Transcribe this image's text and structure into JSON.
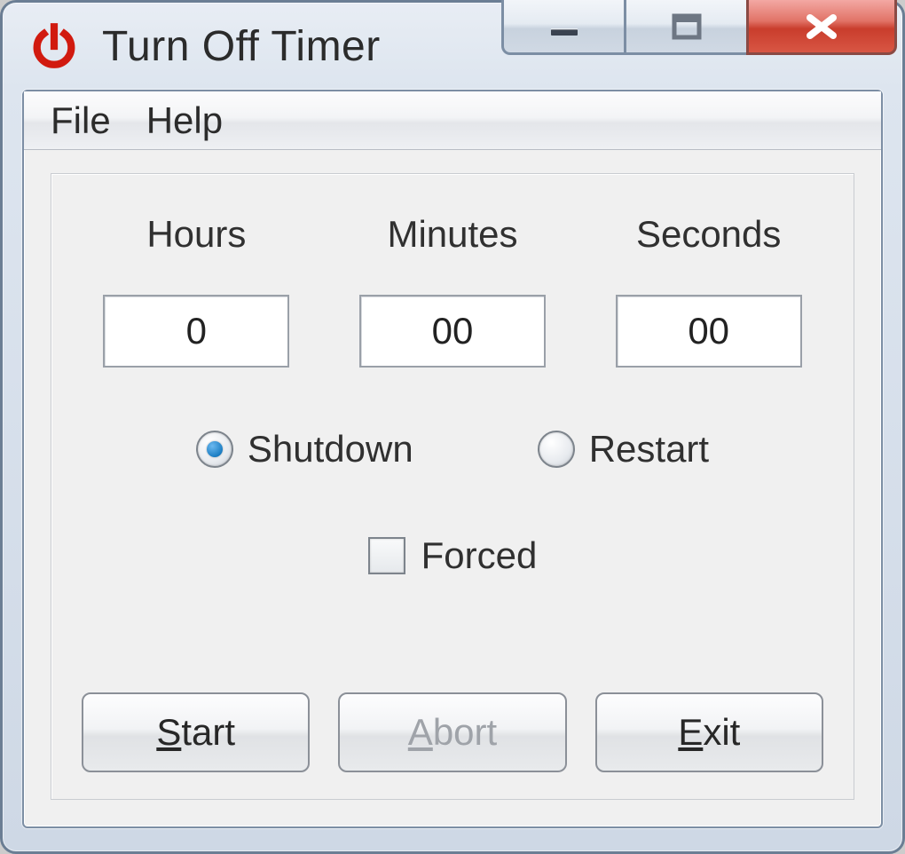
{
  "window": {
    "title": "Turn Off Timer"
  },
  "menu": {
    "file": "File",
    "help": "Help"
  },
  "labels": {
    "hours": "Hours",
    "minutes": "Minutes",
    "seconds": "Seconds"
  },
  "inputs": {
    "hours": "0",
    "minutes": "00",
    "seconds": "00"
  },
  "radios": {
    "shutdown": "Shutdown",
    "restart": "Restart",
    "selected": "shutdown"
  },
  "checkbox": {
    "forced": "Forced",
    "checked": false
  },
  "buttons": {
    "start": {
      "accel": "S",
      "rest": "tart"
    },
    "abort": {
      "accel": "A",
      "rest": "bort"
    },
    "exit": {
      "accel": "E",
      "rest": "xit"
    }
  }
}
